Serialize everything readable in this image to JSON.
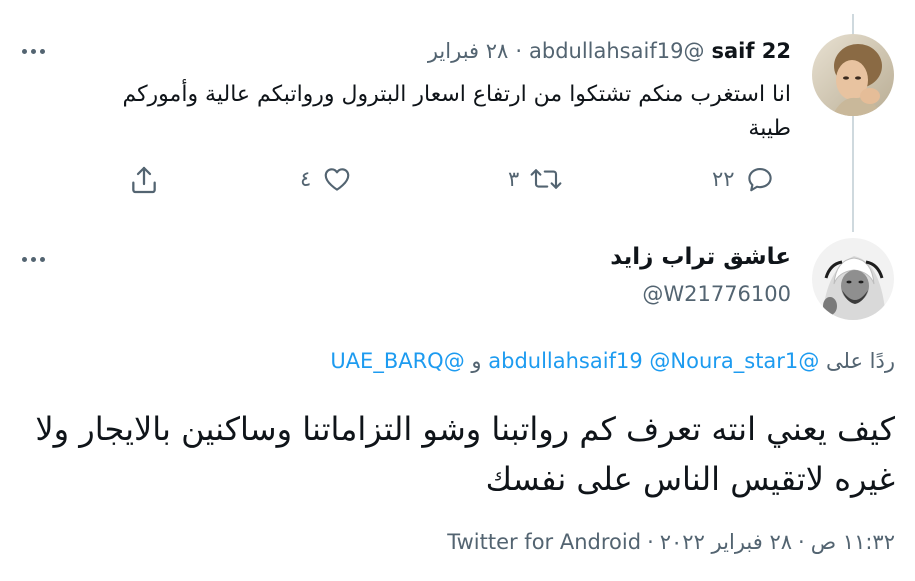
{
  "tweet1": {
    "display_name": "saif 22",
    "handle": "@abdullahsaif19",
    "separator": "·",
    "date": "٢٨ فبراير",
    "text": "انا استغرب منكم تشتكوا من ارتفاع اسعار البترول ورواتبكم عالية وأموركم طيبة",
    "actions": {
      "reply_count": "٢٢",
      "retweet_count": "٣",
      "like_count": "٤"
    }
  },
  "tweet2": {
    "display_name": "عاشق تراب زايد",
    "handle": "@W21776100",
    "reply_prefix": "ردًا على",
    "reply_mentions": [
      "@abdullahsaif19",
      "@Noura_star1",
      "@UAE_BARQ"
    ],
    "reply_joiner": "و",
    "text": "كيف يعني انته تعرف كم رواتبنا وشو التزاماتنا وساكنين بالايجار ولا غيره لاتقيس الناس على نفسك",
    "time": "١١:٣٢ ص",
    "date": "٢٨ فبراير ٢٠٢٢",
    "separator": "·",
    "source": "Twitter for Android"
  },
  "colors": {
    "text": "#0f1419",
    "secondary": "#536471",
    "link": "#1d9bf0",
    "thread_line": "#cfd9de"
  },
  "icons": [
    "reply-icon",
    "retweet-icon",
    "like-icon",
    "share-icon",
    "more-icon"
  ]
}
